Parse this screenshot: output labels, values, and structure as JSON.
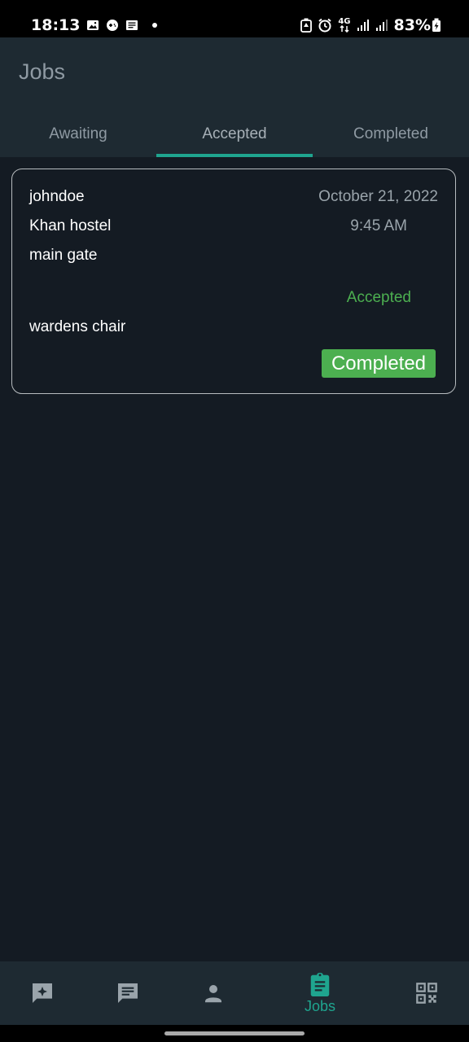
{
  "status_bar": {
    "time": "18:13",
    "network": "4G",
    "battery": "83%"
  },
  "app_bar": {
    "title": "Jobs"
  },
  "tabs": [
    {
      "label": "Awaiting",
      "active": false
    },
    {
      "label": "Accepted",
      "active": true
    },
    {
      "label": "Completed",
      "active": false
    }
  ],
  "job": {
    "username": "johndoe",
    "date": "October 21, 2022",
    "hostel": "Khan hostel",
    "time": "9:45 AM",
    "location": "main gate",
    "status": "Accepted",
    "item": "wardens chair",
    "action_label": "Completed"
  },
  "bottom_nav": {
    "items": [
      {
        "name": "chat-sparkle",
        "icon": "chat-sparkle-icon"
      },
      {
        "name": "messages",
        "icon": "message-icon"
      },
      {
        "name": "profile",
        "icon": "person-icon"
      },
      {
        "name": "jobs",
        "icon": "clipboard-icon",
        "label": "Jobs",
        "active": true
      },
      {
        "name": "qr",
        "icon": "qr-code-icon"
      }
    ]
  },
  "colors": {
    "background": "#141b23",
    "app_bar": "#1e2a32",
    "accent": "#1fa58f",
    "success": "#4caf50"
  }
}
